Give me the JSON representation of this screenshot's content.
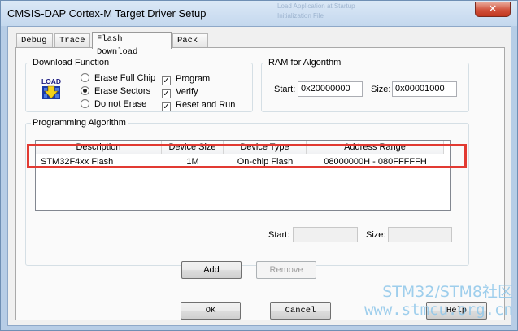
{
  "window": {
    "title": "CMSIS-DAP Cortex-M Target Driver Setup",
    "close_glyph": "✕",
    "background_ghost": [
      "Load Application at Startup",
      "Initialization File"
    ]
  },
  "tabs": [
    {
      "label": "Debug",
      "active": false
    },
    {
      "label": "Trace",
      "active": false
    },
    {
      "label": "Flash Download",
      "active": true
    },
    {
      "label": "Pack",
      "active": false
    }
  ],
  "download_function": {
    "legend": "Download Function",
    "icon_text": "LOAD",
    "radios": [
      {
        "label": "Erase Full Chip",
        "checked": false
      },
      {
        "label": "Erase Sectors",
        "checked": true
      },
      {
        "label": "Do not Erase",
        "checked": false
      }
    ],
    "checkboxes": [
      {
        "label": "Program",
        "checked": true
      },
      {
        "label": "Verify",
        "checked": true
      },
      {
        "label": "Reset and Run",
        "checked": true
      }
    ],
    "check_glyph": "✓"
  },
  "ram_for_algorithm": {
    "legend": "RAM for Algorithm",
    "start_label": "Start:",
    "start_value": "0x20000000",
    "size_label": "Size:",
    "size_value": "0x00001000"
  },
  "programming_algorithm": {
    "legend": "Programming Algorithm",
    "columns": [
      "Description",
      "Device Size",
      "Device Type",
      "Address Range"
    ],
    "rows": [
      {
        "description": "STM32F4xx Flash",
        "device_size": "1M",
        "device_type": "On-chip Flash",
        "address_range": "08000000H - 080FFFFFH"
      }
    ],
    "start_label": "Start:",
    "start_value": "",
    "size_label": "Size:",
    "size_value": "",
    "add_label": "Add",
    "remove_label": "Remove"
  },
  "footer": {
    "ok_label": "OK",
    "cancel_label": "Cancel",
    "help_label": "Help"
  },
  "watermark": {
    "line1": "STM32/STM8社区",
    "line2": "www.stmcu.org.cn"
  },
  "colors": {
    "highlight_border": "#e23a32",
    "title_bar": "#c4d8ee",
    "watermark": "#8fc7ea"
  }
}
